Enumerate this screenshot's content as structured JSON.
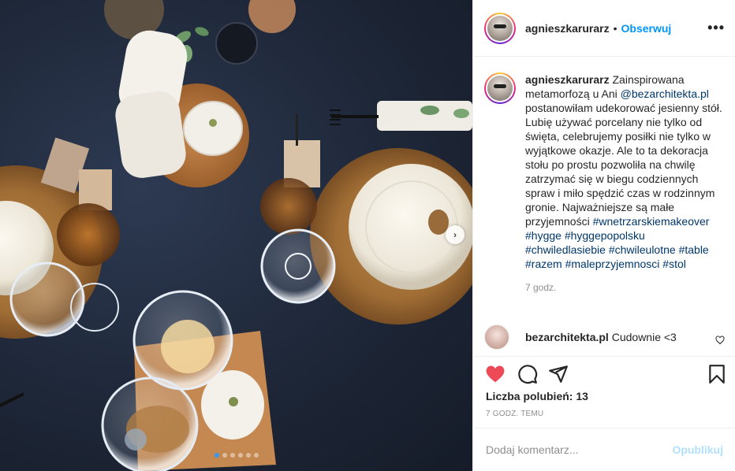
{
  "header": {
    "username": "agnieszkarurarz",
    "separator": "•",
    "follow_label": "Obserwuj",
    "more_icon": "more-horizontal-icon",
    "more_glyph": "•••"
  },
  "caption": {
    "username": "agnieszkarurarz",
    "text_1": "Zainspirowana metamorfozą u Ani ",
    "mention": "@bezarchitekta.pl",
    "text_2": " postanowiłam udekorować jesienny stół. Lubię używać porcelany nie tylko od święta, celebrujemy posiłki nie tylko w wyjątkowe okazje. Ale to ta dekoracja stołu po prostu pozwoliła na chwilę zatrzymać się w biegu codziennych spraw i miło spędzić czas w rodzinnym gronie. Najważniejsze są małe przyjemności",
    "hashtags": [
      "#wnetrzarskiemakeover",
      "#hygge",
      "#hyggepopolsku",
      "#chwiledlasiebie",
      "#chwileulotne",
      "#table",
      "#razem",
      "#maleprzyjemnosci",
      "#stol"
    ],
    "time": "7 godz."
  },
  "comment": {
    "username": "bezarchitekta.pl",
    "text": "Cudownie <3"
  },
  "actions": {
    "like_icon": "heart-filled-icon",
    "comment_icon": "comment-icon",
    "share_icon": "share-icon",
    "save_icon": "bookmark-icon",
    "like_color": "#ed4956"
  },
  "likes_label": "Liczba polubień: 13",
  "post_time": "7 GODZ. TEMU",
  "comment_box": {
    "placeholder": "Dodaj komentarz...",
    "publish_label": "Opublikuj",
    "publish_color": "#b2dffc"
  },
  "photo": {
    "next_glyph": "›",
    "carousel_count": 6,
    "carousel_active": 1
  },
  "colors": {
    "accent": "#0095f6",
    "link": "#00376b",
    "muted": "#8e8e8e",
    "tablecloth": "#1e2738"
  }
}
